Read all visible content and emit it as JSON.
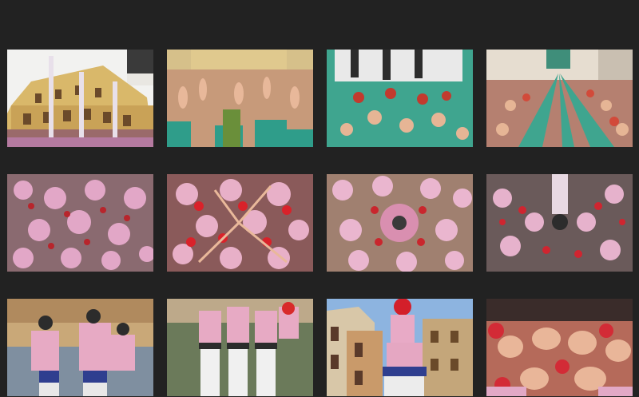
{
  "gallery": {
    "background": "#222222",
    "thumbnails": [
      {
        "subject": "castell-tower-in-plaza-photo"
      },
      {
        "subject": "crowd-raising-hands-photo"
      },
      {
        "subject": "green-shirt-base-photo"
      },
      {
        "subject": "pinya-overhead-teal-photo"
      },
      {
        "subject": "pink-pinya-overhead-photo"
      },
      {
        "subject": "pink-pinya-red-caps-photo"
      },
      {
        "subject": "pink-pinya-circle-photo"
      },
      {
        "subject": "pink-pinya-center-photo"
      },
      {
        "subject": "castellers-climbing-photo"
      },
      {
        "subject": "castellers-white-trousers-photo"
      },
      {
        "subject": "child-top-red-helmet-photo"
      },
      {
        "subject": "hands-reaching-closeup-photo"
      }
    ]
  }
}
